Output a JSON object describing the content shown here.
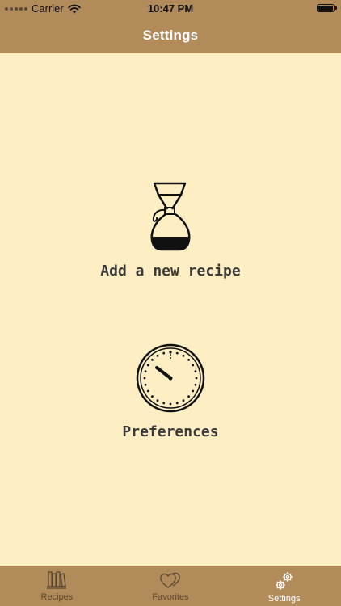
{
  "status_bar": {
    "carrier": "Carrier",
    "time": "10:47 PM"
  },
  "nav": {
    "title": "Settings"
  },
  "actions": {
    "add_recipe": {
      "label": "Add a new recipe",
      "icon": "chemex-coffee-maker-icon"
    },
    "preferences": {
      "label": "Preferences",
      "icon": "timer-dial-icon"
    }
  },
  "tabs": [
    {
      "label": "Recipes",
      "icon": "books-icon",
      "active": false
    },
    {
      "label": "Favorites",
      "icon": "hearts-icon",
      "active": false
    },
    {
      "label": "Settings",
      "icon": "gears-icon",
      "active": true
    }
  ],
  "colors": {
    "bar": "#b28b5b",
    "background": "#fdeec4",
    "active_tab": "#ffffff",
    "inactive_tab": "#5a4630"
  }
}
